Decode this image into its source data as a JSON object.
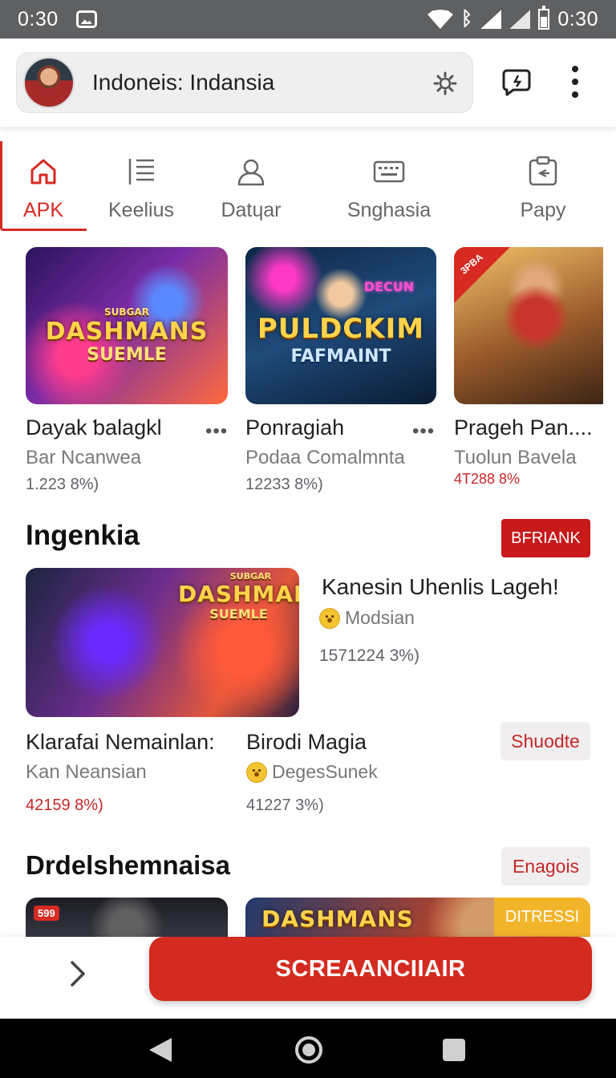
{
  "status_bar": {
    "time_left": "0:30",
    "time_right": "0:30"
  },
  "header": {
    "search_text": "Indoneis: Indansia"
  },
  "tabs": [
    {
      "label": "APK",
      "icon": "home-icon",
      "active": true
    },
    {
      "label": "Keelius",
      "icon": "list-icon",
      "active": false
    },
    {
      "label": "Datɥar",
      "icon": "person-icon",
      "active": false
    },
    {
      "label": "Snghasia",
      "icon": "keyboard-icon",
      "active": false
    },
    {
      "label": "Papy",
      "icon": "clipboard-icon",
      "active": false
    }
  ],
  "top_row": [
    {
      "title": "Dayak ƅalagkl",
      "subtitle": "Bar Ncanwea",
      "meta": "1.223 8%)",
      "art_title": "DASHMANS",
      "art_sub": "SUEMLE",
      "art_top": "SUBGAR"
    },
    {
      "title": "Ponragiah",
      "subtitle": "Podaa Comalmnta",
      "meta": "12233 8%)",
      "art_title": "PULDCKIM",
      "art_sub": "FAFMAINT",
      "art_top": "DECUN"
    },
    {
      "title": "Prageh Pan....",
      "subtitle": "Tuolun Bavela",
      "meta": "4T288 8%",
      "corner": "3PBA"
    }
  ],
  "section1": {
    "title": "Ingenkia",
    "button": "BFRIANK",
    "feature_title": "Kanesin Uhenlis Lageh!",
    "feature_sub": "Modsian",
    "feature_meta": "1571224 3%)",
    "art_title": "DASHMANS",
    "art_sub": "SUEMLE",
    "art_top": "SUBGAR",
    "left_card": {
      "title": "Klarafai Nemainlan:",
      "subtitle": "Kan Neansian",
      "meta": "42159 8%)"
    },
    "right_card": {
      "title": "Birodi Magia",
      "subtitle": "DegesSunek",
      "meta": "41227 3%)"
    },
    "side_button": "Shuodte"
  },
  "section2": {
    "title": "Drdelshemnaisa",
    "button": "Enagois",
    "badge_left": "599",
    "badge_right": "DITRESSI",
    "art_title": "DASHMANS"
  },
  "action_bar": {
    "download_label": "SCREAANCIIAIR"
  },
  "colors": {
    "accent": "#d32b1f",
    "text": "#202124",
    "muted": "#7a7a7a"
  }
}
